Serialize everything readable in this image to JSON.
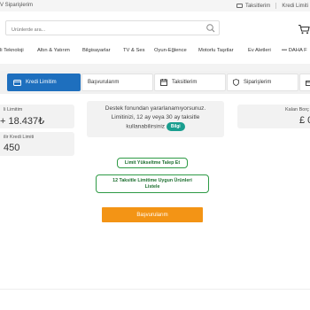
{
  "topbar": {
    "orders_label": "V Siparişlerim",
    "installments_label": "Taksitlerim",
    "credit_limit_label": "Kredi Limiti"
  },
  "search": {
    "placeholder": "Ürünlerde ara..."
  },
  "categories": [
    "li Teknoloji",
    "Altın & Yatırım",
    "Bilgisayarlar",
    "TV & Ses",
    "Oyun-Eğlence",
    "Motorlu Taşıtlar",
    "Ev Aletleri",
    "DAHA F"
  ],
  "tabs": [
    {
      "label": "Kredi Limitim",
      "icon": "card-icon",
      "active": true
    },
    {
      "label": "Başvurularım",
      "icon": "none",
      "active": false
    },
    {
      "label": "Taksitlerim",
      "icon": "calendar-icon",
      "active": false
    },
    {
      "label": "Siparişlerim",
      "icon": "shield-icon",
      "active": false
    }
  ],
  "limit_card": {
    "label": "li Limitim",
    "value": "+ 18.437₺"
  },
  "available_card": {
    "label": "ilir Kredi Limiti",
    "value": "450"
  },
  "debt_card": {
    "label": "Kalan Borç",
    "value": "£ 0"
  },
  "notice": {
    "line1": "Destek fonundan yararlanamıyorsunuz.",
    "line2": "Limitinizi, 12 ay veya 30 ay taksitle",
    "line3": "kullanabilirsiniz",
    "badge": "Bilgi"
  },
  "actions": {
    "limit_increase": "Limit Yükseltme Talep Et",
    "installment_products_line1": "12 Taksitle Limitime Uygun Ürünleri",
    "installment_products_line2": "Listele",
    "applications": "Başvurularım"
  },
  "colors": {
    "tab_active": "#1e6fbe",
    "badge": "#1a9e8f",
    "outline_green": "#2e9a45",
    "primary_orange": "#f39415"
  }
}
